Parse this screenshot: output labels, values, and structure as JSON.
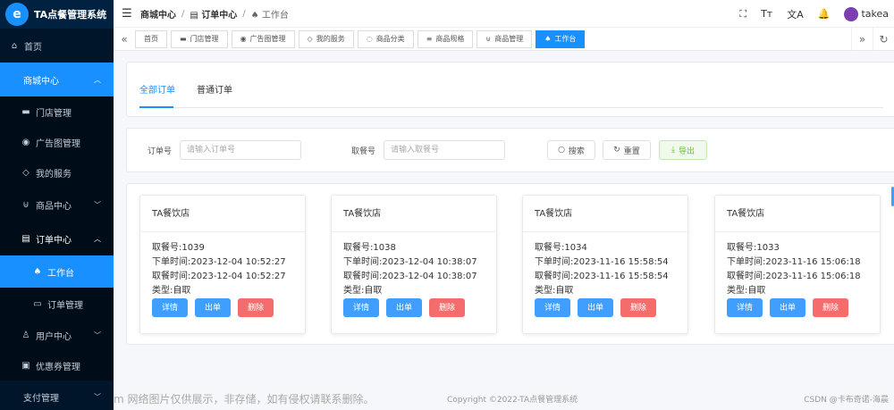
{
  "app": {
    "title": "TA点餐管理系统",
    "logo_letter": "e"
  },
  "sidebar": {
    "items": [
      {
        "label": "首页",
        "icon": "home-icon",
        "glyph": "⌂"
      },
      {
        "label": "商城中心",
        "icon": "",
        "glyph": ""
      },
      {
        "label": "门店管理",
        "icon": "shop-icon",
        "glyph": "▬"
      },
      {
        "label": "广告图管理",
        "icon": "camera-icon",
        "glyph": "◉"
      },
      {
        "label": "我的服务",
        "icon": "service-icon",
        "glyph": "◇"
      },
      {
        "label": "商品中心",
        "icon": "cart-icon",
        "glyph": "⊍"
      },
      {
        "label": "订单中心",
        "icon": "clipboard-icon",
        "glyph": "▤"
      },
      {
        "label": "工作台",
        "icon": "bell-icon",
        "glyph": "♠"
      },
      {
        "label": "订单管理",
        "icon": "list-icon",
        "glyph": "▭"
      },
      {
        "label": "用户中心",
        "icon": "user-icon",
        "glyph": "♙"
      },
      {
        "label": "优惠券管理",
        "icon": "coupon-icon",
        "glyph": "▣"
      },
      {
        "label": "支付管理",
        "icon": "",
        "glyph": ""
      }
    ]
  },
  "topbar": {
    "breadcrumb": [
      {
        "label": "商城中心"
      },
      {
        "label": "订单中心",
        "glyph": "▤"
      },
      {
        "label": "工作台",
        "glyph": "♠"
      }
    ],
    "username": "takea",
    "icons": {
      "fullscreen": "⛶",
      "font": "Tт",
      "translate": "文A",
      "bell": "🔔"
    }
  },
  "tabs": [
    {
      "label": "首页",
      "glyph": ""
    },
    {
      "label": "门店管理",
      "glyph": "▬"
    },
    {
      "label": "广告图管理",
      "glyph": "◉"
    },
    {
      "label": "我的服务",
      "glyph": "◇"
    },
    {
      "label": "商品分类",
      "glyph": "◌"
    },
    {
      "label": "商品规格",
      "glyph": "≡"
    },
    {
      "label": "商品管理",
      "glyph": "⊍"
    },
    {
      "label": "工作台",
      "glyph": "♠"
    }
  ],
  "order_tabs": [
    "全部订单",
    "普通订单"
  ],
  "search": {
    "order_no_label": "订单号",
    "order_no_placeholder": "请输入订单号",
    "pickup_label": "取餐号",
    "pickup_placeholder": "请输入取餐号",
    "search_btn": "搜索",
    "reset_btn": "重置",
    "export_btn": "导出"
  },
  "orders": [
    {
      "shop": "TA餐饮店",
      "pickup": "取餐号:1039",
      "order_time": "下单时间:2023-12-04 10:52:27",
      "pickup_time": "取餐时间:2023-12-04 10:52:27",
      "type": "类型:自取"
    },
    {
      "shop": "TA餐饮店",
      "pickup": "取餐号:1038",
      "order_time": "下单时间:2023-12-04 10:38:07",
      "pickup_time": "取餐时间:2023-12-04 10:38:07",
      "type": "类型:自取"
    },
    {
      "shop": "TA餐饮店",
      "pickup": "取餐号:1034",
      "order_time": "下单时间:2023-11-16 15:58:54",
      "pickup_time": "取餐时间:2023-11-16 15:58:54",
      "type": "类型:自取"
    },
    {
      "shop": "TA餐饮店",
      "pickup": "取餐号:1033",
      "order_time": "下单时间:2023-11-16 15:06:18",
      "pickup_time": "取餐时间:2023-11-16 15:06:18",
      "type": "类型:自取"
    }
  ],
  "order_buttons": {
    "detail": "详情",
    "serve": "出单",
    "delete": "删除"
  },
  "footer": {
    "watermark": "m 网络图片仅供展示，非存储，如有侵权请联系删除。",
    "copyright": "Copyright ©2022-TA点餐管理系统",
    "csdn": "CSDN @卡布奇诺-海晨"
  }
}
